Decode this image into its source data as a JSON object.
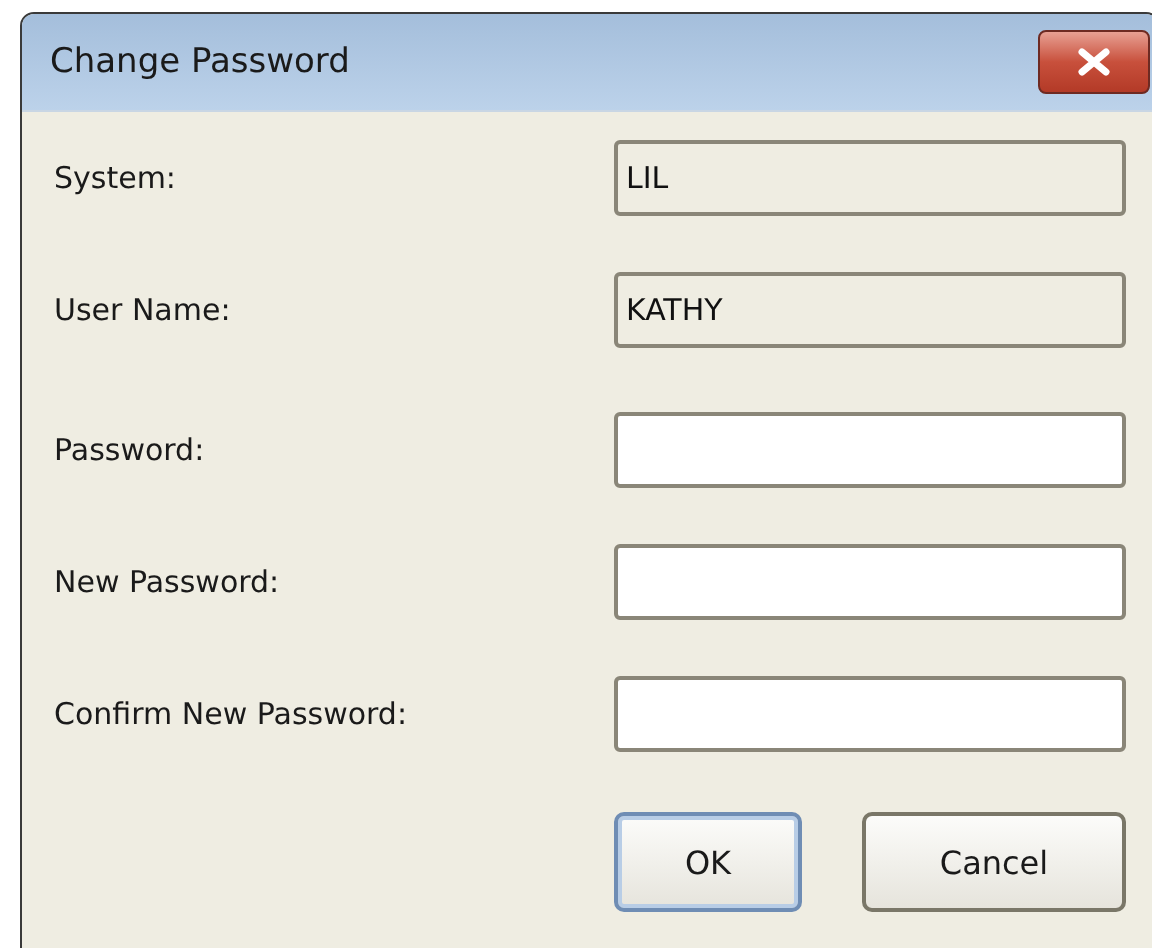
{
  "window": {
    "title": "Change Password"
  },
  "fields": [
    {
      "label": "System:",
      "value": "LIL",
      "read_only": true
    },
    {
      "label": "User Name:",
      "value": "KATHY",
      "read_only": true
    },
    {
      "label": "Password:",
      "read_only": false
    },
    {
      "label": "New Password:",
      "read_only": false
    },
    {
      "label": "Confirm New Password:",
      "read_only": false
    }
  ],
  "buttons": [
    {
      "label": "OK",
      "default": true
    },
    {
      "label": "Cancel",
      "default": false
    }
  ]
}
